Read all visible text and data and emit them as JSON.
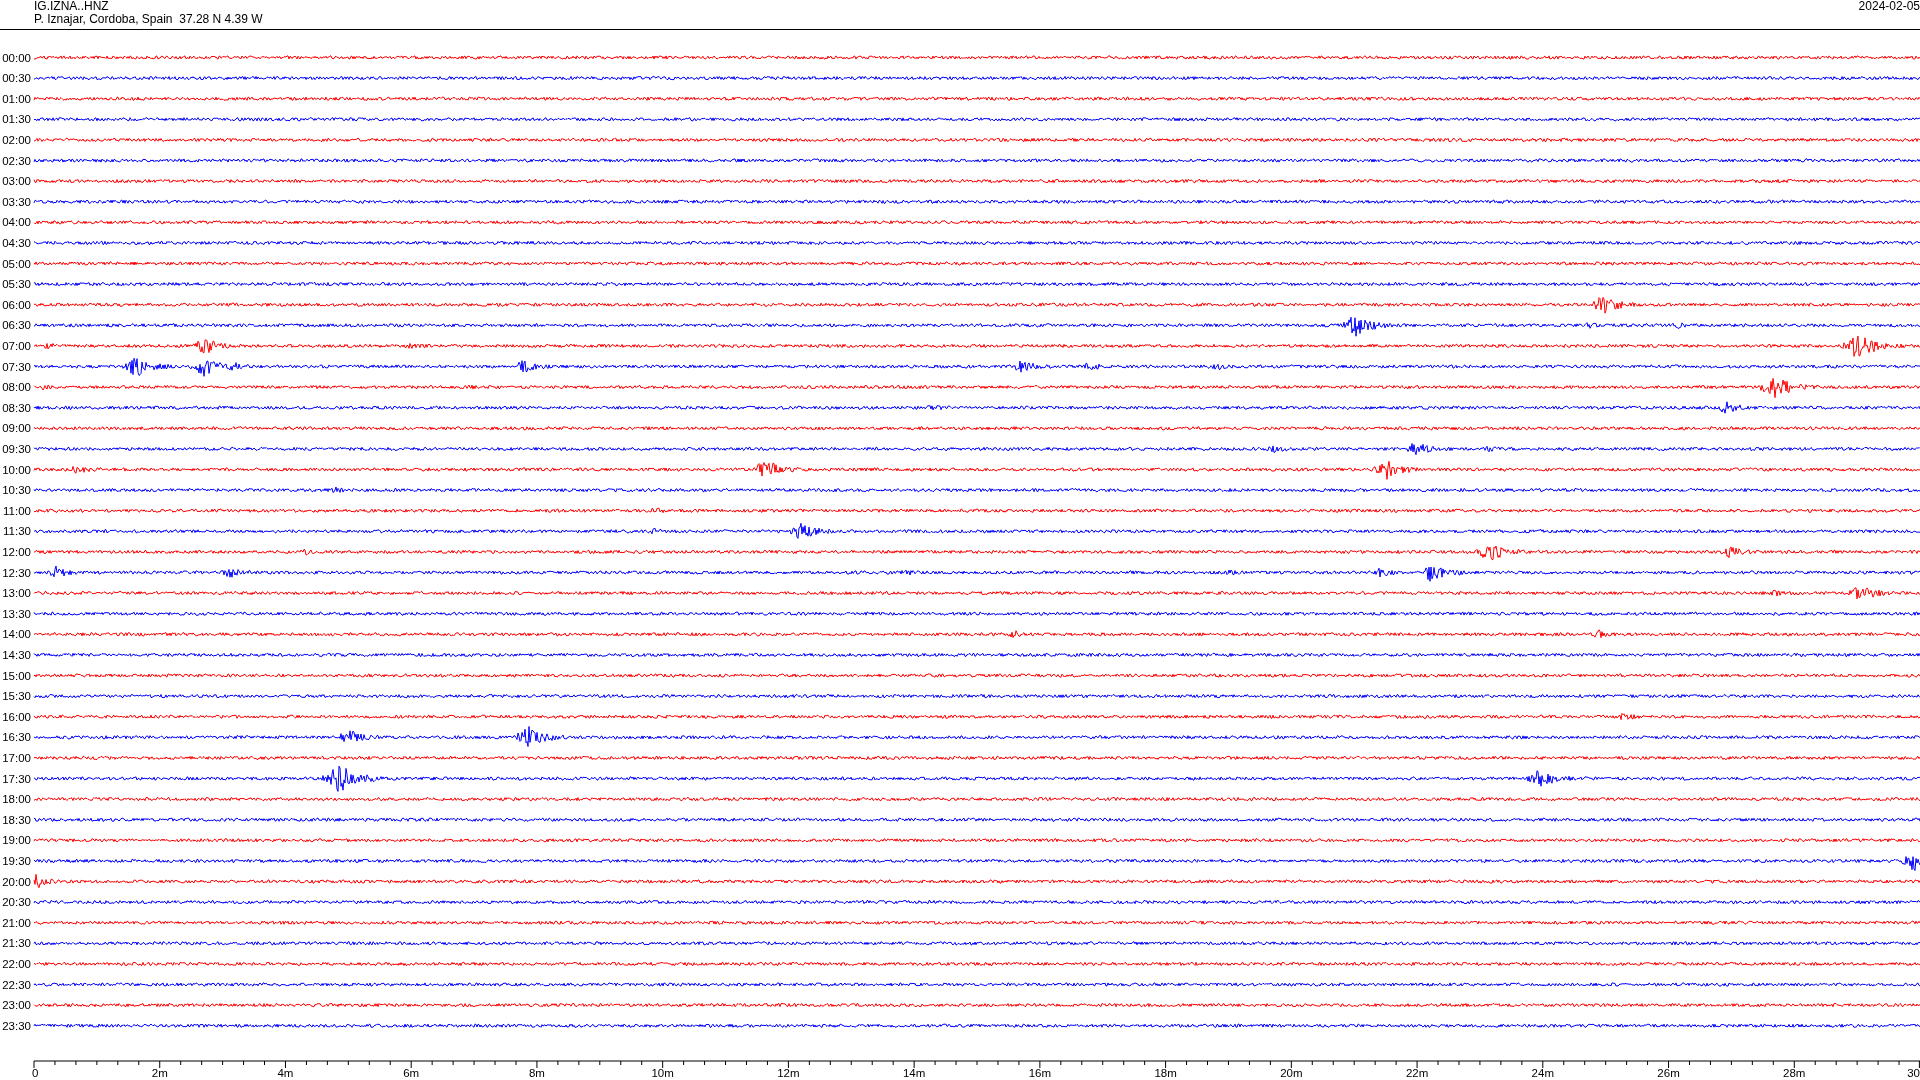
{
  "header": {
    "station": "IG.IZNA..HNZ",
    "location": "P. Iznajar, Cordoba, Spain  37.28 N 4.39 W",
    "date": "2024-02-05"
  },
  "chart": {
    "rows": [
      {
        "label": "00:00",
        "color": "#ff0000"
      },
      {
        "label": "00:30",
        "color": "#0000ff"
      },
      {
        "label": "01:00",
        "color": "#ff0000"
      },
      {
        "label": "01:30",
        "color": "#0000ff"
      },
      {
        "label": "02:00",
        "color": "#ff0000"
      },
      {
        "label": "02:30",
        "color": "#0000ff"
      },
      {
        "label": "03:00",
        "color": "#ff0000"
      },
      {
        "label": "03:30",
        "color": "#0000ff"
      },
      {
        "label": "04:00",
        "color": "#ff0000"
      },
      {
        "label": "04:30",
        "color": "#0000ff"
      },
      {
        "label": "05:00",
        "color": "#ff0000"
      },
      {
        "label": "05:30",
        "color": "#0000ff"
      },
      {
        "label": "06:00",
        "color": "#ff0000"
      },
      {
        "label": "06:30",
        "color": "#0000ff"
      },
      {
        "label": "07:00",
        "color": "#ff0000"
      },
      {
        "label": "07:30",
        "color": "#0000ff"
      },
      {
        "label": "08:00",
        "color": "#ff0000"
      },
      {
        "label": "08:30",
        "color": "#0000ff"
      },
      {
        "label": "09:00",
        "color": "#ff0000"
      },
      {
        "label": "09:30",
        "color": "#0000ff"
      },
      {
        "label": "10:00",
        "color": "#ff0000"
      },
      {
        "label": "10:30",
        "color": "#0000ff"
      },
      {
        "label": "11:00",
        "color": "#ff0000"
      },
      {
        "label": "11:30",
        "color": "#0000ff"
      },
      {
        "label": "12:00",
        "color": "#ff0000"
      },
      {
        "label": "12:30",
        "color": "#0000ff"
      },
      {
        "label": "13:00",
        "color": "#ff0000"
      },
      {
        "label": "13:30",
        "color": "#0000ff"
      },
      {
        "label": "14:00",
        "color": "#ff0000"
      },
      {
        "label": "14:30",
        "color": "#0000ff"
      },
      {
        "label": "15:00",
        "color": "#ff0000"
      },
      {
        "label": "15:30",
        "color": "#0000ff"
      },
      {
        "label": "16:00",
        "color": "#ff0000"
      },
      {
        "label": "16:30",
        "color": "#0000ff"
      },
      {
        "label": "17:00",
        "color": "#ff0000"
      },
      {
        "label": "17:30",
        "color": "#0000ff"
      },
      {
        "label": "18:00",
        "color": "#ff0000"
      },
      {
        "label": "18:30",
        "color": "#0000ff"
      },
      {
        "label": "19:00",
        "color": "#ff0000"
      },
      {
        "label": "19:30",
        "color": "#0000ff"
      },
      {
        "label": "20:00",
        "color": "#ff0000"
      },
      {
        "label": "20:30",
        "color": "#0000ff"
      },
      {
        "label": "21:00",
        "color": "#ff0000"
      },
      {
        "label": "21:30",
        "color": "#0000ff"
      },
      {
        "label": "22:00",
        "color": "#ff0000"
      },
      {
        "label": "22:30",
        "color": "#0000ff"
      },
      {
        "label": "23:00",
        "color": "#ff0000"
      },
      {
        "label": "23:30",
        "color": "#0000ff"
      }
    ],
    "x_ticks": [
      "0",
      "2m",
      "4m",
      "6m",
      "8m",
      "10m",
      "12m",
      "14m",
      "16m",
      "18m",
      "20m",
      "22m",
      "24m",
      "26m",
      "28m",
      "30"
    ]
  }
}
